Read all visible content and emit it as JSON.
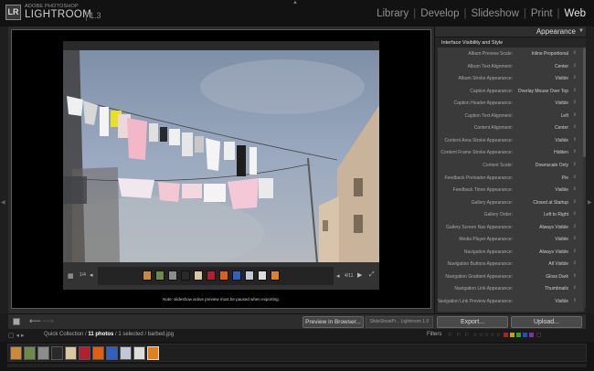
{
  "app": {
    "logo_text": "LR",
    "brand_top": "ADOBE PHOTOSHOP",
    "brand_name": "LIGHTROOM",
    "version": "1.3"
  },
  "modules": [
    {
      "label": "Library",
      "active": false
    },
    {
      "label": "Develop",
      "active": false
    },
    {
      "label": "Slideshow",
      "active": false
    },
    {
      "label": "Print",
      "active": false
    },
    {
      "label": "Web",
      "active": true
    }
  ],
  "preview": {
    "export_note": "Note: slideshow active preview must be paused when exporting.",
    "page_counter": "1/4",
    "slide_counter": "4/11"
  },
  "panel": {
    "title": "Appearance",
    "section_title": "Interface Visibility and Style",
    "settings": [
      {
        "label": "Album Preview Scale:",
        "value": "Inline Proportional"
      },
      {
        "label": "Album Text Alignment:",
        "value": "Center"
      },
      {
        "label": "Album Stroke Appearance:",
        "value": "Visible"
      },
      {
        "label": "Caption Appearance:",
        "value": "Overlay Mouse Over Top"
      },
      {
        "label": "Caption Header Appearance:",
        "value": "Visible"
      },
      {
        "label": "Caption Text Alignment:",
        "value": "Left"
      },
      {
        "label": "Content Alignment:",
        "value": "Center"
      },
      {
        "label": "Content Area Stroke Appearance:",
        "value": "Visible"
      },
      {
        "label": "Content Frame Stroke Appearance:",
        "value": "Hidden"
      },
      {
        "label": "Content Scale:",
        "value": "Downscale Only"
      },
      {
        "label": "Feedback Preloader Appearance:",
        "value": "Pie"
      },
      {
        "label": "Feedback Timer Appearance:",
        "value": "Visible"
      },
      {
        "label": "Gallery Appearance:",
        "value": "Closed at Startup"
      },
      {
        "label": "Gallery Order:",
        "value": "Left to Right"
      },
      {
        "label": "Gallery Screen Nav Appearance:",
        "value": "Always Visible"
      },
      {
        "label": "Media Player Appearance:",
        "value": "Visible"
      },
      {
        "label": "Navigation Appearance:",
        "value": "Always Visible"
      },
      {
        "label": "Navigation Buttons Appearance:",
        "value": "All Visible"
      },
      {
        "label": "Navigation Gradient Appearance:",
        "value": "Gloss Dark"
      },
      {
        "label": "Navigation Link Appearance:",
        "value": "Thumbnails"
      },
      {
        "label": "Navigation Link Preview Appearance:",
        "value": "Visible"
      }
    ]
  },
  "toolbar": {
    "preview_button": "Preview in Browser...",
    "engine_label": "SlideShowPr... Lightroom 1.0",
    "export_button": "Export...",
    "upload_button": "Upload..."
  },
  "filmstrip": {
    "collection": "Quick Collection /",
    "photo_count": "11 photos",
    "selection": "/ 1 selected / barbed.jpg",
    "filters_label": "Filters",
    "thumb_colors": [
      "#c98a3a",
      "#6e8a4a",
      "#8c8c8c",
      "#2a2a2a",
      "#d9c9a0",
      "#b02030",
      "#e06010",
      "#3060c0",
      "#c0c8d8",
      "#dcdcdc",
      "#e08020"
    ],
    "selected_index": 10
  },
  "colors": {
    "accent": "#e6e6e6",
    "panel_bg": "#3a3a3a",
    "sky": "#8fa1ba"
  }
}
